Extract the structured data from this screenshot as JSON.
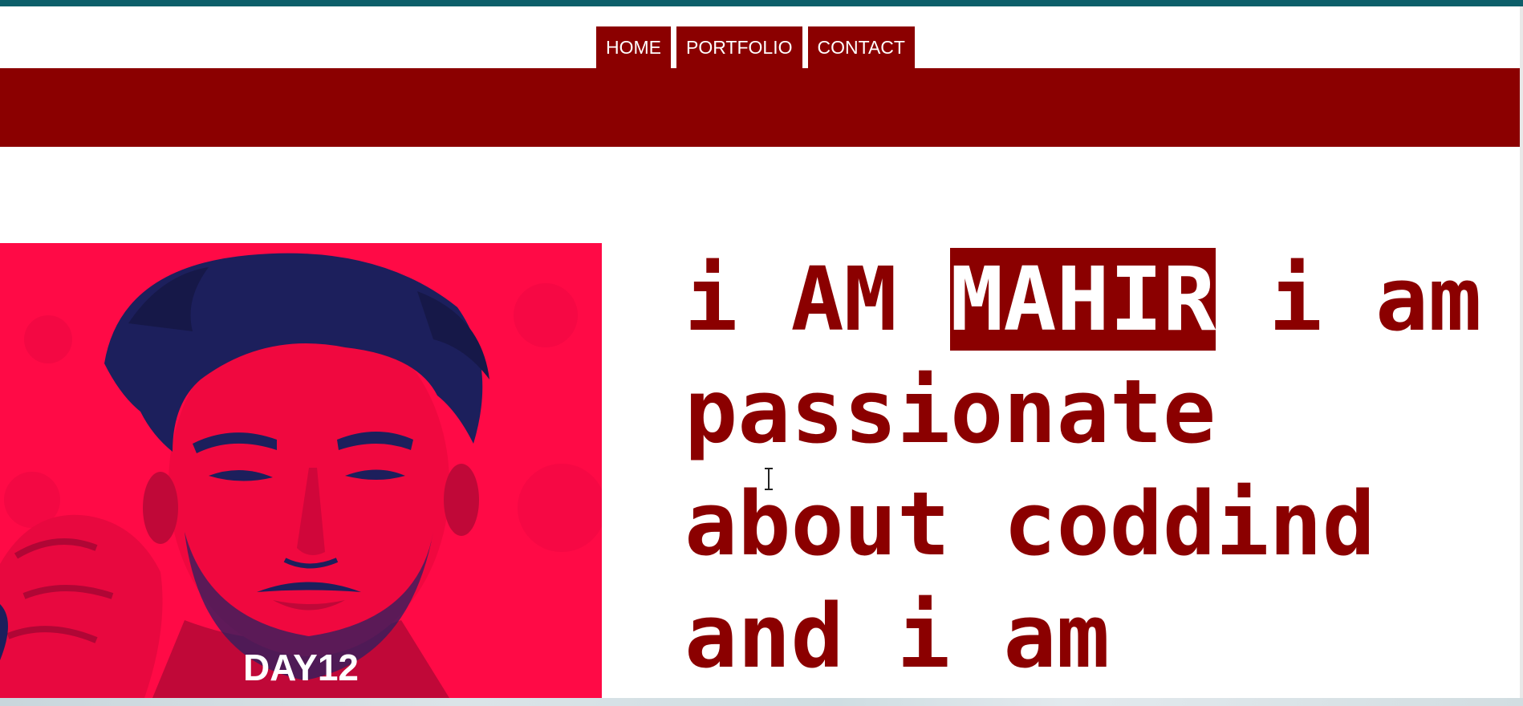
{
  "nav": {
    "items": [
      {
        "label": "HOME"
      },
      {
        "label": "PORTFOLIO"
      },
      {
        "label": "CONTACT"
      }
    ]
  },
  "hero": {
    "photo_caption": "DAY12",
    "headline_before": "i AM ",
    "headline_highlight": "MAHIR",
    "headline_after": " i am passionate about coddind and i am"
  },
  "colors": {
    "accent": "#8b0000",
    "photo_red": "#ff0a46",
    "photo_navy": "#1c1f5c",
    "top_strip": "#0d5f6a"
  },
  "icons": {
    "cursor": "text-cursor-icon"
  }
}
